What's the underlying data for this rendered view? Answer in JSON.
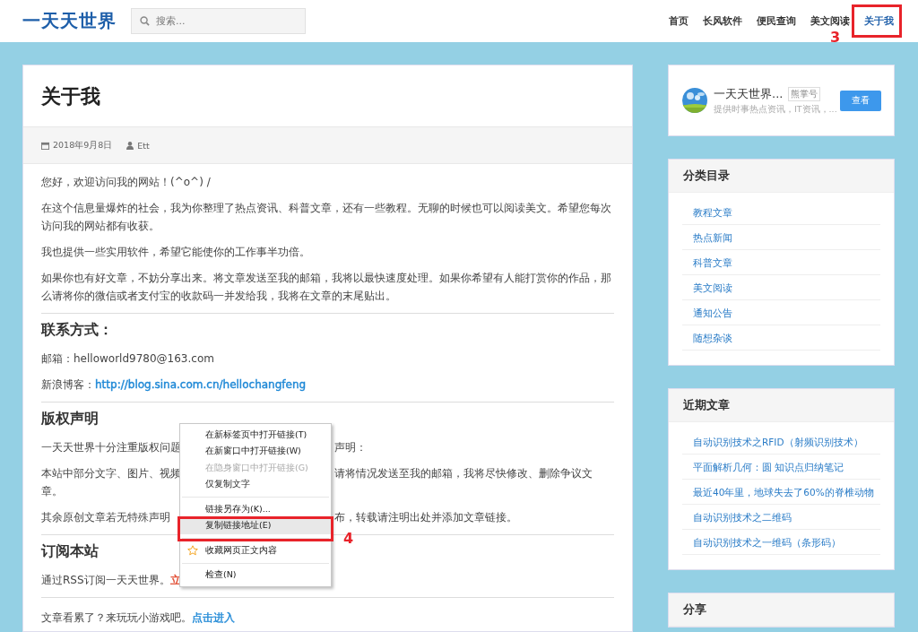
{
  "header": {
    "logo": "一天天世界",
    "search": {
      "placeholder": "搜索..."
    },
    "nav": [
      {
        "label": "首页",
        "selected": false
      },
      {
        "label": "长风软件",
        "selected": false
      },
      {
        "label": "便民查询",
        "selected": false
      },
      {
        "label": "美文阅读",
        "selected": false
      },
      {
        "label": "关于我",
        "selected": true
      }
    ]
  },
  "article": {
    "title": "关于我",
    "date": "2018年9月8日",
    "author": "Ett",
    "blocks": [
      {
        "kind": "paragraph",
        "text": "您好，欢迎访问我的网站！(^o^) /"
      },
      {
        "kind": "paragraph",
        "text": "在这个信息量爆炸的社会，我为你整理了热点资讯、科普文章，还有一些教程。无聊的时候也可以阅读美文。希望您每次访问我的网站都有收获。"
      },
      {
        "kind": "paragraph",
        "text": "我也提供一些实用软件，希望它能使你的工作事半功倍。"
      },
      {
        "kind": "paragraph",
        "text": "如果你也有好文章，不妨分享出来。将文章发送至我的邮箱，我将以最快速度处理。如果你希望有人能打赏你的作品，那么请将你的微信或者支付宝的收款码一并发给我，我将在文章的末尾贴出。"
      },
      {
        "kind": "rule"
      },
      {
        "kind": "heading",
        "text": "联系方式："
      },
      {
        "kind": "paragraph",
        "text": "邮箱：helloworld9780@163.com"
      },
      {
        "kind": "link-line",
        "text": "新浪博客：",
        "link": "http://blog.sina.com.cn/hellochangfeng",
        "color": "#1e88d6"
      },
      {
        "kind": "rule"
      },
      {
        "kind": "heading",
        "text": "版权声明"
      },
      {
        "kind": "covered",
        "left": "一天天世界十分注重版权问题",
        "right": "声明："
      },
      {
        "kind": "covered",
        "left": "本站中部分文字、图片、视频",
        "right": "请将情况发送至我的邮箱，我将尽快修改、删除争议文",
        "continuation": "章。"
      },
      {
        "kind": "covered",
        "left": "其余原创文章若无特殊声明",
        "right": "布，转载请注明出处并添加文章链接。"
      },
      {
        "kind": "rule"
      },
      {
        "kind": "heading",
        "text": "订阅本站"
      },
      {
        "kind": "link-line",
        "text": "通过RSS订阅一天天世界。",
        "link": "立",
        "color": "#e0452a"
      },
      {
        "kind": "rule"
      },
      {
        "kind": "link-line",
        "text": "文章看累了？来玩玩小游戏吧。",
        "link": "点击进入",
        "color": "#1e88d6"
      }
    ]
  },
  "profile": {
    "name": "一天天世界...",
    "badge": "熊掌号",
    "description": "提供时事热点资讯，IT资讯，...",
    "button": "查看"
  },
  "widgets": [
    {
      "title": "分类目录",
      "links": [
        "教程文章",
        "热点新闻",
        "科普文章",
        "美文阅读",
        "通知公告",
        "随想杂谈"
      ]
    },
    {
      "title": "近期文章",
      "links": [
        "自动识别技术之RFID（射频识别技术）",
        "平面解析几何：圆 知识点归纳笔记",
        "最近40年里，地球失去了60%的脊椎动物",
        "自动识别技术之二维码",
        "自动识别技术之一维码（条形码）"
      ]
    },
    {
      "title": "分享"
    }
  ],
  "context_menu": [
    {
      "kind": "item",
      "label": "在新标签页中打开链接(T)",
      "disabled": false,
      "selected": false
    },
    {
      "kind": "item",
      "label": "在新窗口中打开链接(W)",
      "disabled": false,
      "selected": false
    },
    {
      "kind": "item",
      "label": "在隐身窗口中打开链接(G)",
      "disabled": true,
      "selected": false
    },
    {
      "kind": "item",
      "label": "仅复制文字",
      "disabled": false,
      "selected": false
    },
    {
      "kind": "separator"
    },
    {
      "kind": "item",
      "label": "链接另存为(K)...",
      "disabled": false,
      "selected": false
    },
    {
      "kind": "item",
      "label": "复制链接地址(E)",
      "disabled": false,
      "selected": true
    },
    {
      "kind": "separator"
    },
    {
      "kind": "starred",
      "label": "收藏网页正文内容",
      "disabled": false,
      "selected": false
    },
    {
      "kind": "separator"
    },
    {
      "kind": "item",
      "label": "检查(N)",
      "disabled": false,
      "selected": false
    }
  ],
  "annotations": [
    {
      "label": "3"
    },
    {
      "label": "4"
    }
  ]
}
